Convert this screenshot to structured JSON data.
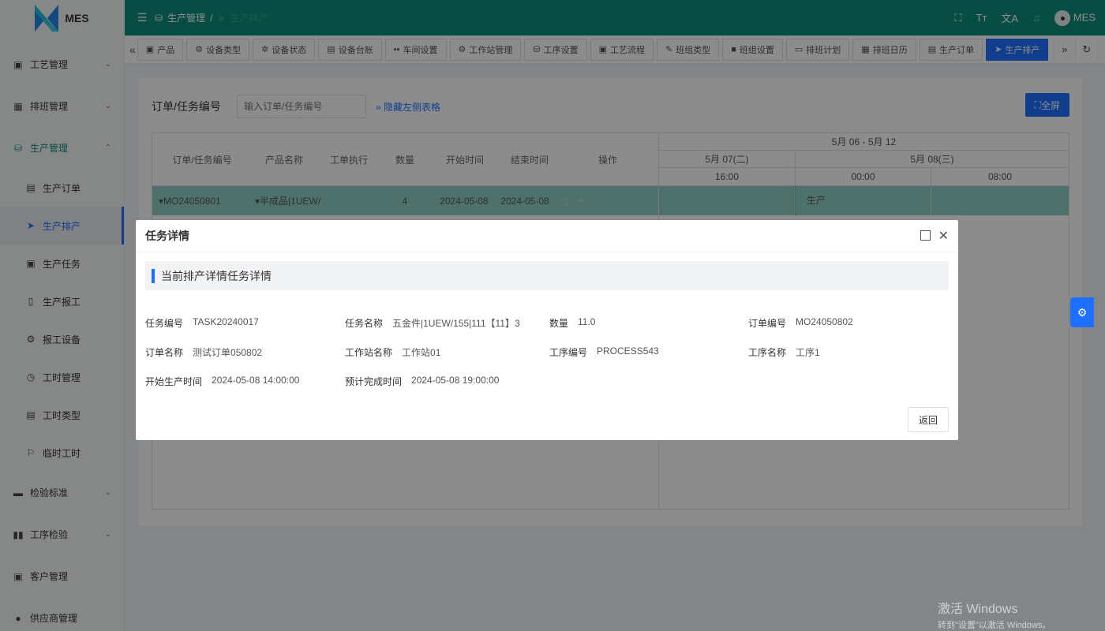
{
  "app": {
    "name": "MES",
    "user": "MES"
  },
  "breadcrumb": [
    "生产管理",
    "生产排产"
  ],
  "sidebar": {
    "items": [
      {
        "label": "工艺管理",
        "icon": "package-icon"
      },
      {
        "label": "排班管理",
        "icon": "calendar-icon"
      },
      {
        "label": "生产管理",
        "icon": "database-icon"
      },
      {
        "label": "生产订单",
        "icon": "clipboard-icon"
      },
      {
        "label": "生产排产",
        "icon": "send-icon"
      },
      {
        "label": "生产任务",
        "icon": "package-icon"
      },
      {
        "label": "生产报工",
        "icon": "phone-icon"
      },
      {
        "label": "报工设备",
        "icon": "gear-icon"
      },
      {
        "label": "工时管理",
        "icon": "clock-icon"
      },
      {
        "label": "工时类型",
        "icon": "document-icon"
      },
      {
        "label": "临时工时",
        "icon": "flag-icon"
      },
      {
        "label": "检验标准",
        "icon": "monitor-icon"
      },
      {
        "label": "工序检验",
        "icon": "book-icon"
      },
      {
        "label": "客户管理",
        "icon": "contact-icon"
      },
      {
        "label": "供应商管理",
        "icon": "user-icon"
      }
    ]
  },
  "tabs": [
    {
      "label": "产品"
    },
    {
      "label": "设备类型"
    },
    {
      "label": "设备状态"
    },
    {
      "label": "设备台账"
    },
    {
      "label": "车间设置"
    },
    {
      "label": "工作站管理"
    },
    {
      "label": "工序设置"
    },
    {
      "label": "工艺流程"
    },
    {
      "label": "班组类型"
    },
    {
      "label": "班组设置"
    },
    {
      "label": "排班计划"
    },
    {
      "label": "排班日历"
    },
    {
      "label": "生产订单"
    },
    {
      "label": "生产排产"
    }
  ],
  "page": {
    "filter_label": "订单/任务编号",
    "filter_placeholder": "输入订单/任务编号",
    "hide_left_link": "隐藏左侧表格",
    "fullscreen_button": "全屏"
  },
  "grid": {
    "columns": [
      "订单/任务编号",
      "产品名称",
      "工单执行",
      "数量",
      "开始时间",
      "结束时间",
      "操作"
    ],
    "row": {
      "order_no": "MO24050801",
      "product": "半成品|1UEW/",
      "qty": "4",
      "start": "2024-05-08",
      "end": "2024-05-08"
    },
    "gantt": {
      "range": "5月 06 - 5月 12",
      "days": [
        "5月 07(二)",
        "5月 08(三)"
      ],
      "hours": [
        "16:00",
        "00:00",
        "08:00"
      ],
      "bar_label": "生产"
    }
  },
  "dialog": {
    "title": "任务详情",
    "section_title": "当前排产详情任务详情",
    "fields": [
      [
        {
          "label": "任务编号",
          "value": "TASK20240017"
        },
        {
          "label": "任务名称",
          "value": "五金件|1UEW/155|111【11】3"
        },
        {
          "label": "数量",
          "value": "11.0"
        },
        {
          "label": "订单编号",
          "value": "MO24050802"
        }
      ],
      [
        {
          "label": "订单名称",
          "value": "测试订单050802"
        },
        {
          "label": "工作站名称",
          "value": "工作站01"
        },
        {
          "label": "工序编号",
          "value": "PROCESS543"
        },
        {
          "label": "工序名称",
          "value": "工序1"
        }
      ],
      [
        {
          "label": "开始生产时间",
          "value": "2024-05-08 14:00:00"
        },
        {
          "label": "预计完成时间",
          "value": "2024-05-08 19:00:00"
        }
      ]
    ],
    "back_button": "返回"
  },
  "watermark": {
    "line1": "激活 Windows",
    "line2": "转到\"设置\"以激活 Windows。"
  }
}
